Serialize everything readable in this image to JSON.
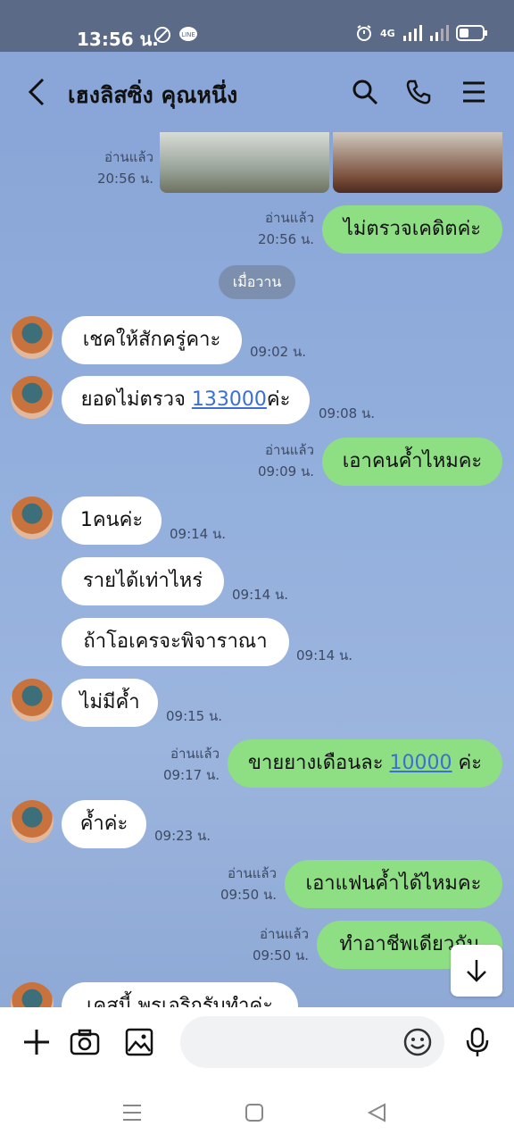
{
  "status": {
    "time": "13:56 น.",
    "network": "4G"
  },
  "header": {
    "title": "เฮงลิสซิ่ง คุณหนึ่ง"
  },
  "date_separator": "เมื่อวาน",
  "top_images": {
    "read": "อ่านแล้ว",
    "time": "20:56 น."
  },
  "messages": [
    {
      "side": "right",
      "text": "ไม่ตรวจเคดิตค่ะ",
      "read": "อ่านแล้ว",
      "time": "20:56 น."
    },
    {
      "side": "left",
      "text": "เชคให้สักครู่คาะ",
      "time": "09:02 น.",
      "avatar": true
    },
    {
      "side": "left",
      "text_before": "ยอดไม่ตรวจ ",
      "link": "133000",
      "text_after": "ค่ะ",
      "time": "09:08 น.",
      "avatar": true
    },
    {
      "side": "right",
      "text": "เอาคนค้ำไหมคะ",
      "read": "อ่านแล้ว",
      "time": "09:09 น."
    },
    {
      "side": "left",
      "text": "1คนค่ะ",
      "time": "09:14 น.",
      "avatar": true
    },
    {
      "side": "left",
      "text": "รายได้เท่าไหร่",
      "time": "09:14 น."
    },
    {
      "side": "left",
      "text": "ถ้าโอเครจะพิจาราณา",
      "time": "09:14 น."
    },
    {
      "side": "left",
      "text": "ไม่มีค้ำ",
      "time": "09:15 น.",
      "avatar": true
    },
    {
      "side": "right",
      "text_before": "ขายยางเดือนละ ",
      "link": "10000",
      "text_after": " ค่ะ",
      "read": "อ่านแล้ว",
      "time": "09:17 น."
    },
    {
      "side": "left",
      "text": "ค้ำค่ะ",
      "time": "09:23 น.",
      "avatar": true
    },
    {
      "side": "right",
      "text": "เอาแฟนค้ำได้ไหมคะ",
      "read": "อ่านแล้ว",
      "time": "09:50 น."
    },
    {
      "side": "right",
      "text": "ทำอาชีพเดียวกัน",
      "read": "อ่านแล้ว",
      "time": "09:50 น."
    },
    {
      "side": "left",
      "text": "เคสนี้ พรเอริกรับทำค่ะ",
      "avatar": true
    }
  ],
  "icons": {
    "back": "back-arrow-icon",
    "search": "search-icon",
    "call": "phone-icon",
    "menu": "menu-icon",
    "plus": "plus-icon",
    "camera": "camera-icon",
    "gallery": "image-icon",
    "emoji": "emoji-icon",
    "mic": "microphone-icon",
    "scroll": "arrow-down-icon"
  },
  "colors": {
    "chat_bg": "#8aa6d8",
    "outgoing": "#8ede83",
    "incoming": "#ffffff",
    "link": "#3b6fd6"
  }
}
